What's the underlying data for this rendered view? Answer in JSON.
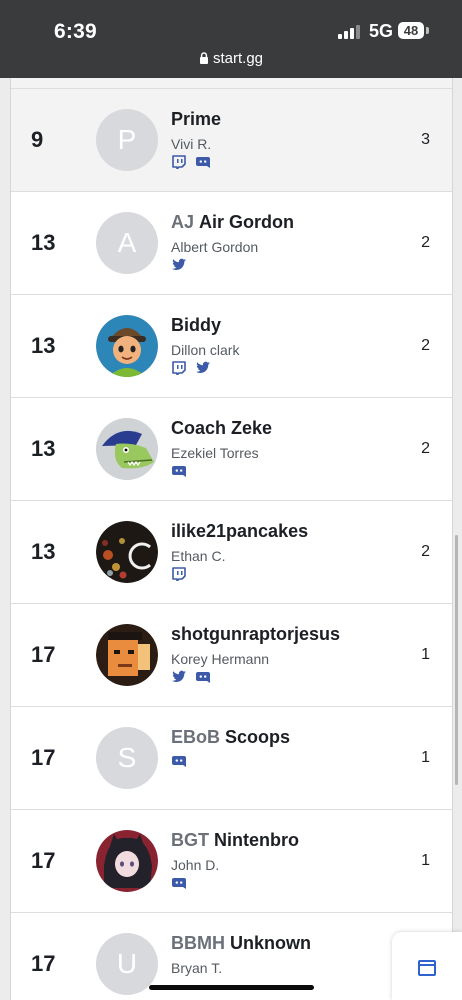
{
  "status_bar": {
    "time": "6:39",
    "network": "5G",
    "battery": "48"
  },
  "browser": {
    "url": "start.gg"
  },
  "colors": {
    "status_bar": "#3a3b3d",
    "accent": "#2e63cf",
    "highlight_row": "#f3f3f3"
  },
  "standings": [
    {
      "placement": "9",
      "prefix": "",
      "gamer_tag": "Prime",
      "real_name": "Vivi R.",
      "avatar": "letter",
      "avatar_letter": "P",
      "socials": [
        "twitch-icon",
        "discord-icon"
      ],
      "score": "3",
      "highlighted": true
    },
    {
      "placement": "13",
      "prefix": "AJ",
      "gamer_tag": "Air Gordon",
      "real_name": "Albert Gordon",
      "avatar": "letter",
      "avatar_letter": "A",
      "socials": [
        "twitter-icon"
      ],
      "score": "2",
      "highlighted": false
    },
    {
      "placement": "13",
      "prefix": "",
      "gamer_tag": "Biddy",
      "real_name": "Dillon clark",
      "avatar": "cartoon-elf",
      "avatar_letter": "",
      "socials": [
        "twitch-icon",
        "twitter-icon"
      ],
      "score": "2",
      "highlighted": false
    },
    {
      "placement": "13",
      "prefix": "",
      "gamer_tag": "Coach Zeke",
      "real_name": "Ezekiel Torres",
      "avatar": "cartoon-crocodile",
      "avatar_letter": "",
      "socials": [
        "discord-icon"
      ],
      "score": "2",
      "highlighted": false
    },
    {
      "placement": "13",
      "prefix": "",
      "gamer_tag": "ilike21pancakes",
      "real_name": "Ethan C.",
      "avatar": "bokeh-lights",
      "avatar_letter": "",
      "socials": [
        "twitch-icon"
      ],
      "score": "2",
      "highlighted": false
    },
    {
      "placement": "17",
      "prefix": "",
      "gamer_tag": "shotgunraptorjesus",
      "real_name": "Korey Hermann",
      "avatar": "pixel-face",
      "avatar_letter": "",
      "socials": [
        "twitter-icon",
        "discord-icon"
      ],
      "score": "1",
      "highlighted": false
    },
    {
      "placement": "17",
      "prefix": "EBoB",
      "gamer_tag": "Scoops",
      "real_name": "",
      "avatar": "letter",
      "avatar_letter": "S",
      "socials": [
        "discord-icon"
      ],
      "score": "1",
      "highlighted": false
    },
    {
      "placement": "17",
      "prefix": "BGT",
      "gamer_tag": "Nintenbro",
      "real_name": "John D.",
      "avatar": "anime-character",
      "avatar_letter": "",
      "socials": [
        "discord-icon"
      ],
      "score": "1",
      "highlighted": false
    },
    {
      "placement": "17",
      "prefix": "BBMH",
      "gamer_tag": "Unknown",
      "real_name": "Bryan T.",
      "avatar": "letter",
      "avatar_letter": "U",
      "socials": [],
      "score": "",
      "highlighted": false
    }
  ]
}
